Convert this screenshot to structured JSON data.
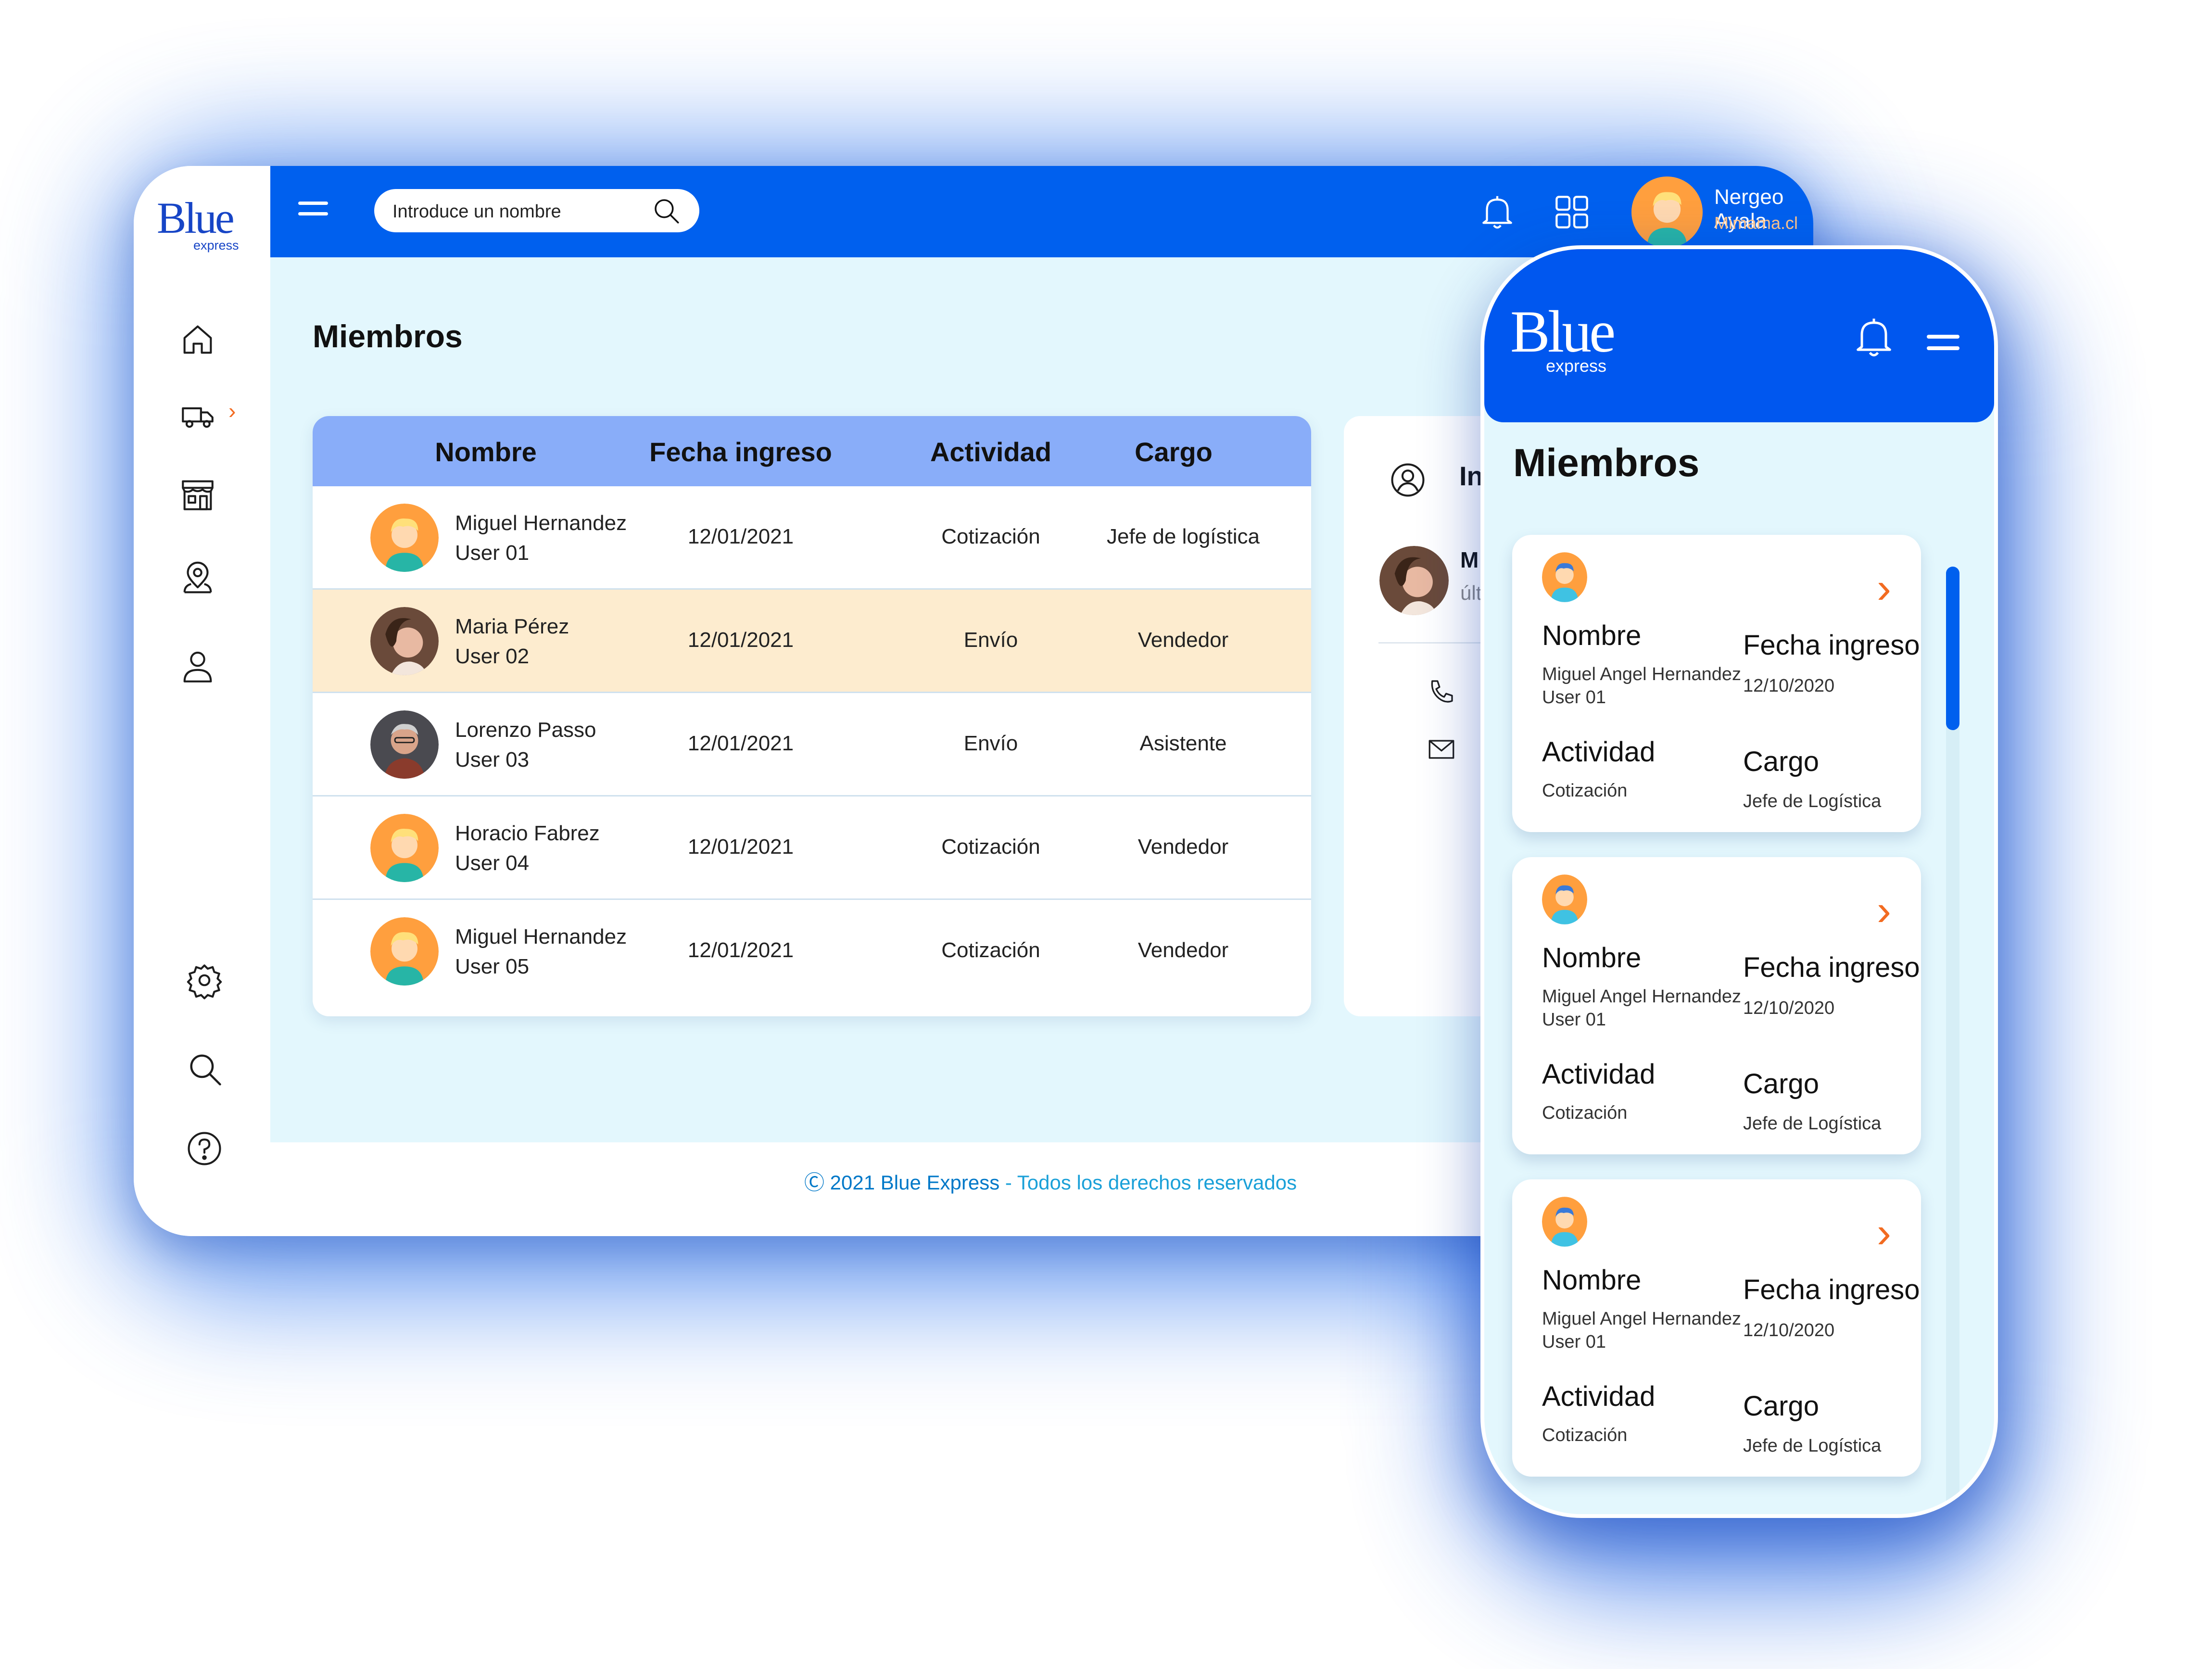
{
  "brand": {
    "logo_main": "Blue",
    "logo_sub": "express"
  },
  "header": {
    "search_placeholder": "Introduce un nombre",
    "user_name": "Nergeo Ayala",
    "user_company": "Mimama.cl"
  },
  "page": {
    "title": "Miembros"
  },
  "table": {
    "columns": [
      "Nombre",
      "Fecha ingreso",
      "Actividad",
      "Cargo"
    ],
    "rows": [
      {
        "name": "Miguel Hernandez",
        "user": "User 01",
        "date": "12/01/2021",
        "activity": "Cotización",
        "role": "Jefe de logística",
        "avatar": "cartoon-avatar",
        "highlighted": false
      },
      {
        "name": "Maria Pérez",
        "user": "User 02",
        "date": "12/01/2021",
        "activity": "Envío",
        "role": "Vendedor",
        "avatar": "photo-avatar",
        "highlighted": true
      },
      {
        "name": "Lorenzo Passo",
        "user": "User 03",
        "date": "12/01/2021",
        "activity": "Envío",
        "role": "Asistente",
        "avatar": "photo-avatar",
        "highlighted": false
      },
      {
        "name": "Horacio Fabrez",
        "user": "User 04",
        "date": "12/01/2021",
        "activity": "Cotización",
        "role": "Vendedor",
        "avatar": "cartoon-avatar",
        "highlighted": false
      },
      {
        "name": "Miguel Hernandez",
        "user": "User 05",
        "date": "12/01/2021",
        "activity": "Cotización",
        "role": "Vendedor",
        "avatar": "cartoon-avatar",
        "highlighted": false
      }
    ]
  },
  "info_panel": {
    "title_partial": "In",
    "name_partial": "M",
    "last_partial": "últ"
  },
  "footer": {
    "copyright": "Ⓒ 2021 Blue Express",
    "rights": " - Todos los derechos reservados"
  },
  "mobile": {
    "title": "Miembros",
    "cards": [
      {
        "label_name": "Nombre",
        "name": "Miguel Angel Hernandez",
        "user": "User 01",
        "label_date": "Fecha ingreso",
        "date": "12/10/2020",
        "label_activity": "Actividad",
        "activity": "Cotización",
        "label_role": "Cargo",
        "role": "Jefe de Logística"
      },
      {
        "label_name": "Nombre",
        "name": "Miguel Angel Hernandez",
        "user": "User 01",
        "label_date": "Fecha ingreso",
        "date": "12/10/2020",
        "label_activity": "Actividad",
        "activity": "Cotización",
        "label_role": "Cargo",
        "role": "Jefe de Logística"
      },
      {
        "label_name": "Nombre",
        "name": "Miguel Angel Hernandez",
        "user": "User 01",
        "label_date": "Fecha ingreso",
        "date": "12/10/2020",
        "label_activity": "Actividad",
        "activity": "Cotización",
        "label_role": "Cargo",
        "role": "Jefe de Logística"
      }
    ]
  },
  "colors": {
    "primary": "#0060ee",
    "header_row": "#89adf9",
    "highlight_row": "#fdeccf",
    "accent": "#f26b21",
    "background": "#e3f7fd"
  },
  "icons": {
    "sidebar": [
      "home-icon",
      "truck-icon",
      "store-icon",
      "location-icon",
      "user-icon",
      "settings-icon",
      "search-icon",
      "help-icon"
    ]
  }
}
